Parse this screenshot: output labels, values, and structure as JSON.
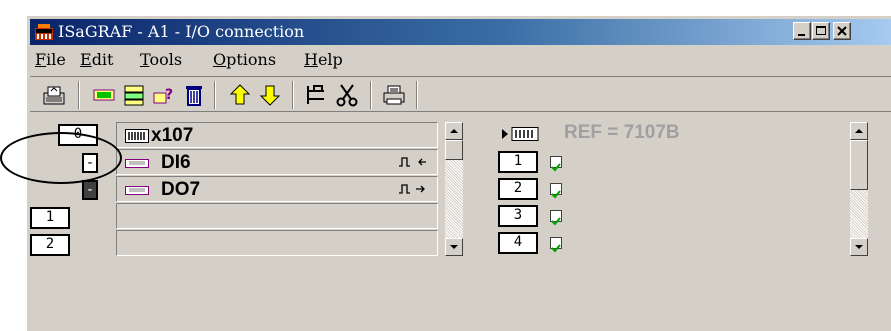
{
  "window": {
    "title": "ISaGRAF - A1 - I/O connection",
    "controls": {
      "minimize": "_",
      "maximize": "□",
      "close": "X"
    }
  },
  "menu": [
    {
      "label": "File",
      "mnemonic": "F",
      "rest": "ile"
    },
    {
      "label": "Edit",
      "mnemonic": "E",
      "rest": "dit"
    },
    {
      "label": "Tools",
      "mnemonic": "T",
      "rest": "ools"
    },
    {
      "label": "Options",
      "mnemonic": "O",
      "rest": "ptions"
    },
    {
      "label": "Help",
      "mnemonic": "H",
      "rest": "elp"
    }
  ],
  "toolbar": {
    "icons": [
      "save-icon",
      "board-icon",
      "connect-icon",
      "help-icon",
      "delete-icon",
      "move-up-icon",
      "move-down-icon",
      "tree-icon",
      "cut-icon",
      "print-icon"
    ]
  },
  "boards": {
    "rows": [
      {
        "slot": "0",
        "name": "x107",
        "icon": "board-icon",
        "style": "white"
      },
      {
        "slot": "-",
        "name": "DI6",
        "icon": "input-board-icon",
        "style": "white",
        "signal": "digital-input-icon"
      },
      {
        "slot": "-",
        "name": "DO7",
        "icon": "output-board-icon",
        "style": "dark",
        "signal": "digital-output-icon"
      },
      {
        "slot": "1",
        "name": "",
        "style": "white"
      },
      {
        "slot": "2",
        "name": "",
        "style": "white"
      }
    ]
  },
  "channels": {
    "ref": "REF = 7107B",
    "rows": [
      {
        "num": "1"
      },
      {
        "num": "2"
      },
      {
        "num": "3"
      },
      {
        "num": "4"
      }
    ]
  },
  "colors": {
    "title_start": "#0a246a",
    "title_end": "#a6caf0",
    "face": "#d4d0c8",
    "ref_text": "#a0a0a0",
    "check_green": "#00a000"
  }
}
